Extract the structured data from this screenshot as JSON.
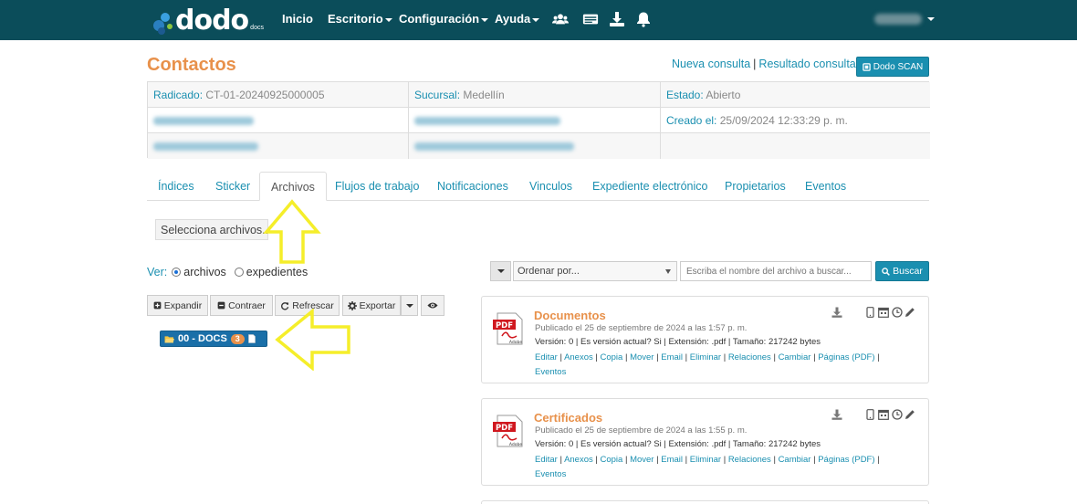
{
  "brand": {
    "logo_text": "dodo",
    "logo_sub": "docs"
  },
  "nav": {
    "items": [
      "Inicio",
      "Escritorio",
      "Configuración",
      "Ayuda"
    ],
    "icons": [
      "users-icon",
      "id-card-icon",
      "download-icon",
      "bell-icon"
    ]
  },
  "header": {
    "title": "Contactos",
    "link_new": "Nueva consulta",
    "link_sep": "|",
    "link_result": "Resultado consulta",
    "scan_button": "Dodo SCAN"
  },
  "info": {
    "radicado_label": "Radicado:",
    "radicado_value": "CT-01-20240925000005",
    "sucursal_label": "Sucursal:",
    "sucursal_value": "Medellín",
    "estado_label": "Estado:",
    "estado_value": "Abierto",
    "creado_label": "Creado el:",
    "creado_value": "25/09/2024 12:33:29 p. m."
  },
  "tabs": [
    "Índices",
    "Sticker",
    "Archivos",
    "Flujos de trabajo",
    "Notificaciones",
    "Vinculos",
    "Expediente electrónico",
    "Propietarios",
    "Eventos"
  ],
  "active_tab": "Archivos",
  "file_select": "Selecciona archivos...",
  "view": {
    "label": "Ver:",
    "option1": "archivos",
    "option2": "expedientes",
    "selected": "archivos"
  },
  "toolbar": {
    "expand": "Expandir",
    "collapse": "Contraer",
    "refresh": "Refrescar",
    "export": "Exportar"
  },
  "tree": {
    "node_label": "00 - DOCS",
    "node_count": "3"
  },
  "search": {
    "order_placeholder": "Ordenar por...",
    "input_placeholder": "Escriba el nombre del archivo a buscar...",
    "button": "Buscar"
  },
  "files": [
    {
      "title": "Documentos",
      "published": "Publicado el 25 de septiembre de 2024 a las 1:57 p. m.",
      "meta": "Versión: 0 | Es versión actual? Si | Extensión: .pdf | Tamaño: 217242 bytes",
      "actions": [
        "Editar",
        "Anexos",
        "Copia",
        "Mover",
        "Email",
        "Eliminar",
        "Relaciones",
        "Cambiar",
        "Páginas (PDF)",
        "Eventos"
      ]
    },
    {
      "title": "Certificados",
      "published": "Publicado el 25 de septiembre de 2024 a las 1:55 p. m.",
      "meta": "Versión: 0 | Es versión actual? Si | Extensión: .pdf | Tamaño: 217242 bytes",
      "actions": [
        "Editar",
        "Anexos",
        "Copia",
        "Mover",
        "Email",
        "Eliminar",
        "Relaciones",
        "Cambiar",
        "Páginas (PDF)",
        "Eventos"
      ]
    }
  ],
  "colors": {
    "navbar": "#0b4d5a",
    "accent": "#e8914b",
    "link": "#1a8fb0",
    "highlight_arrow": "#f5ee2a"
  }
}
